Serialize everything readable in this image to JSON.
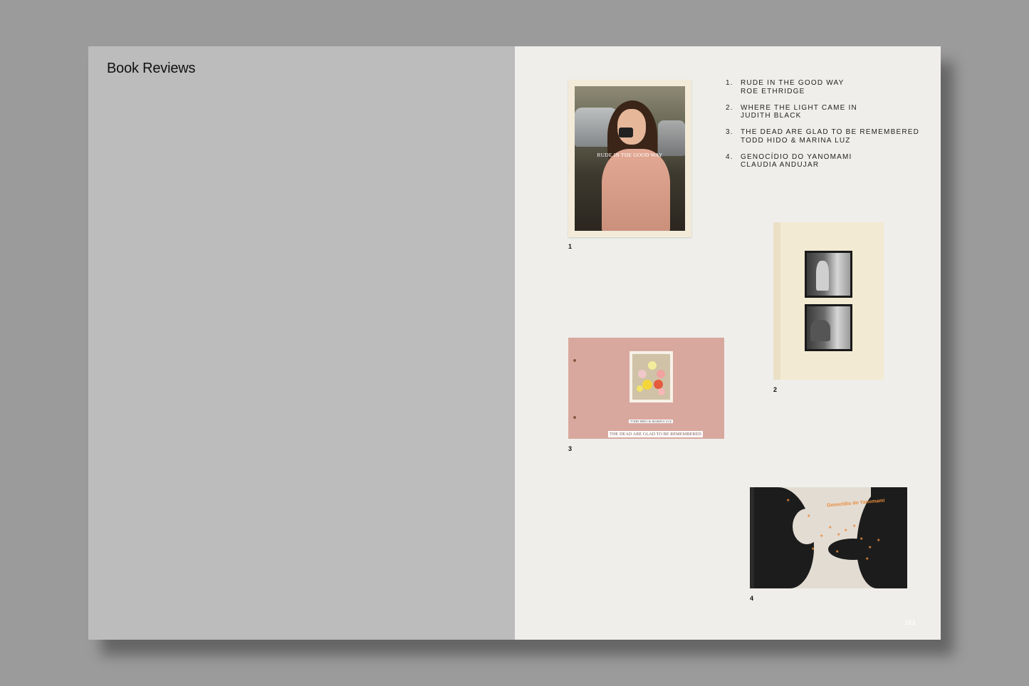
{
  "section_title": "Book Reviews",
  "toc": [
    {
      "num": "1.",
      "title": "RUDE IN THE GOOD WAY",
      "author": "ROE ETHRIDGE"
    },
    {
      "num": "2.",
      "title": "WHERE THE LIGHT CAME IN",
      "author": "JUDITH BLACK"
    },
    {
      "num": "3.",
      "title": "THE DEAD ARE GLAD TO BE REMEMBERED",
      "author": "TODD HIDO & MARINA LUZ"
    },
    {
      "num": "4.",
      "title": "GENOCÍDIO DO YANOMAMI",
      "author": "CLAUDIA ANDUJAR"
    }
  ],
  "captions": {
    "c1": "1",
    "c2": "2",
    "c3": "3",
    "c4": "4"
  },
  "book1": {
    "cover_text": "RUDE IN THE GOOD WAY"
  },
  "book3": {
    "cover_line1": "TODD HIDO & MARINA LUZ",
    "cover_line2": "THE DEAD ARE GLAD TO BE REMEMBERED"
  },
  "book4": {
    "cover_text": "Genocídio do Yanomami"
  },
  "folio": "163",
  "colors": {
    "background": "#9b9b9b",
    "left_page": "#bcbcbc",
    "right_page": "#efeeeb",
    "accent_orange": "#e98b3c"
  }
}
